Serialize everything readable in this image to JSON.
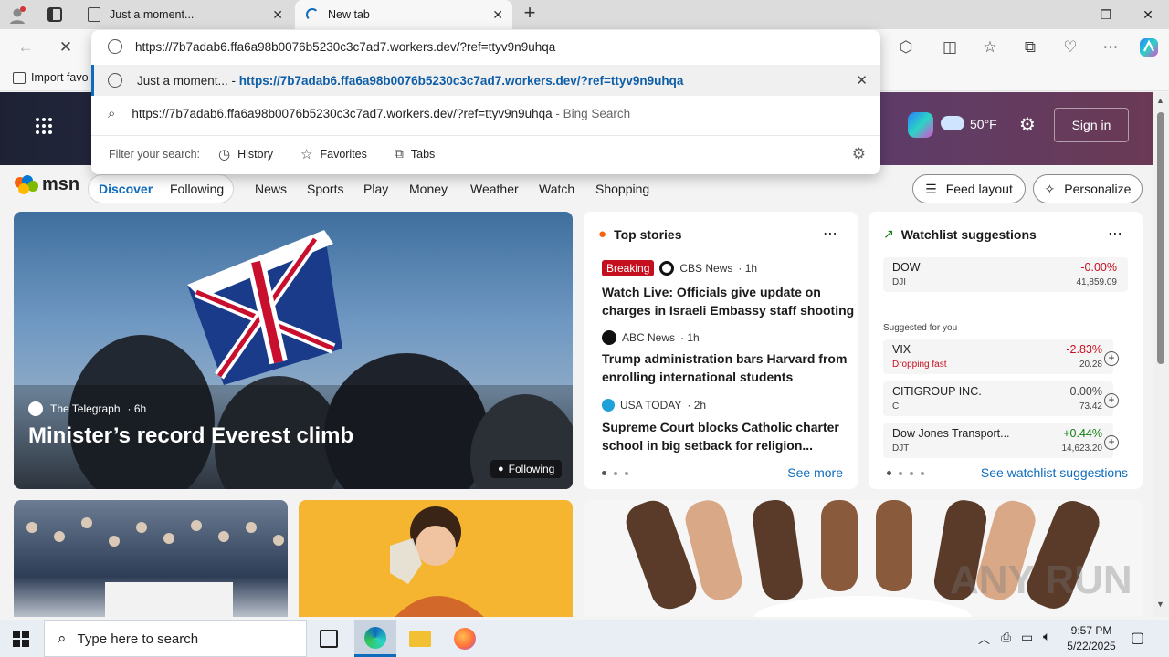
{
  "browser": {
    "tabs": [
      {
        "title": "Just a moment..."
      },
      {
        "title": "New tab"
      }
    ],
    "address": "https://7b7adab6.ffa6a98b0076b5230c3c7ad7.workers.dev/?ref=ttyv9n9uhqa",
    "fav_import": "Import favo"
  },
  "omnibox": {
    "suggestion1_prefix": "Just a moment... - ",
    "suggestion1_url": "https://7b7adab6.ffa6a98b0076b5230c3c7ad7.workers.dev/?ref=ttyv9n9uhqa",
    "suggestion2_text": "https://7b7adab6.ffa6a98b0076b5230c3c7ad7.workers.dev/?ref=ttyv9n9uhqa",
    "suggestion2_suffix": " - Bing Search",
    "filter_label": "Filter your search:",
    "filters": [
      "History",
      "Favorites",
      "Tabs"
    ]
  },
  "msn": {
    "logo": "msn",
    "weather_temp": "50°F",
    "sign_in": "Sign in",
    "nav": [
      "Discover",
      "Following",
      "News",
      "Sports",
      "Play",
      "Money",
      "Weather",
      "Watch",
      "Shopping"
    ],
    "feed_layout": "Feed layout",
    "personalize": "Personalize",
    "hero": {
      "source": "The Telegraph",
      "age": "· 6h",
      "title": "Minister’s record Everest climb",
      "following": "Following"
    },
    "top_stories": {
      "header": "Top stories",
      "items": [
        {
          "badge": "Breaking",
          "source": "CBS News",
          "age": "· 1h",
          "title_line1": "Watch Live: Officials give update on",
          "title_line2": "charges in Israeli Embassy staff shooting"
        },
        {
          "source": "ABC News",
          "age": "· 1h",
          "title_line1": "Trump administration bars Harvard from",
          "title_line2": "enrolling international students"
        },
        {
          "source": "USA TODAY",
          "age": "· 2h",
          "title_line1": "Supreme Court blocks Catholic charter",
          "title_line2": "school in big setback for religion..."
        }
      ],
      "see_more": "See more"
    },
    "watchlist": {
      "header": "Watchlist suggestions",
      "main": {
        "symbol": "DOW",
        "sub": "DJI",
        "pct": "-0.00%",
        "value": "41,859.09"
      },
      "suggested_label": "Suggested for you",
      "items": [
        {
          "symbol": "VIX",
          "sub": "Dropping fast",
          "pct": "-2.83%",
          "value": "20.28",
          "color": "#c50f1f"
        },
        {
          "symbol": "CITIGROUP INC.",
          "sub": "C",
          "pct": "0.00%",
          "value": "73.42",
          "color": "#444444"
        },
        {
          "symbol": "Dow Jones Transport...",
          "sub": "DJT",
          "pct": "+0.44%",
          "value": "14,623.20",
          "color": "#107c10"
        }
      ],
      "see_link": "See watchlist suggestions"
    }
  },
  "taskbar": {
    "search_placeholder": "Type here to search",
    "time": "9:57 PM",
    "date": "5/22/2025"
  },
  "watermark": "ANY RUN",
  "colors": {
    "accent": "#0f6cbd",
    "breaking": "#c50f1f",
    "negative": "#c50f1f",
    "positive": "#107c10"
  }
}
